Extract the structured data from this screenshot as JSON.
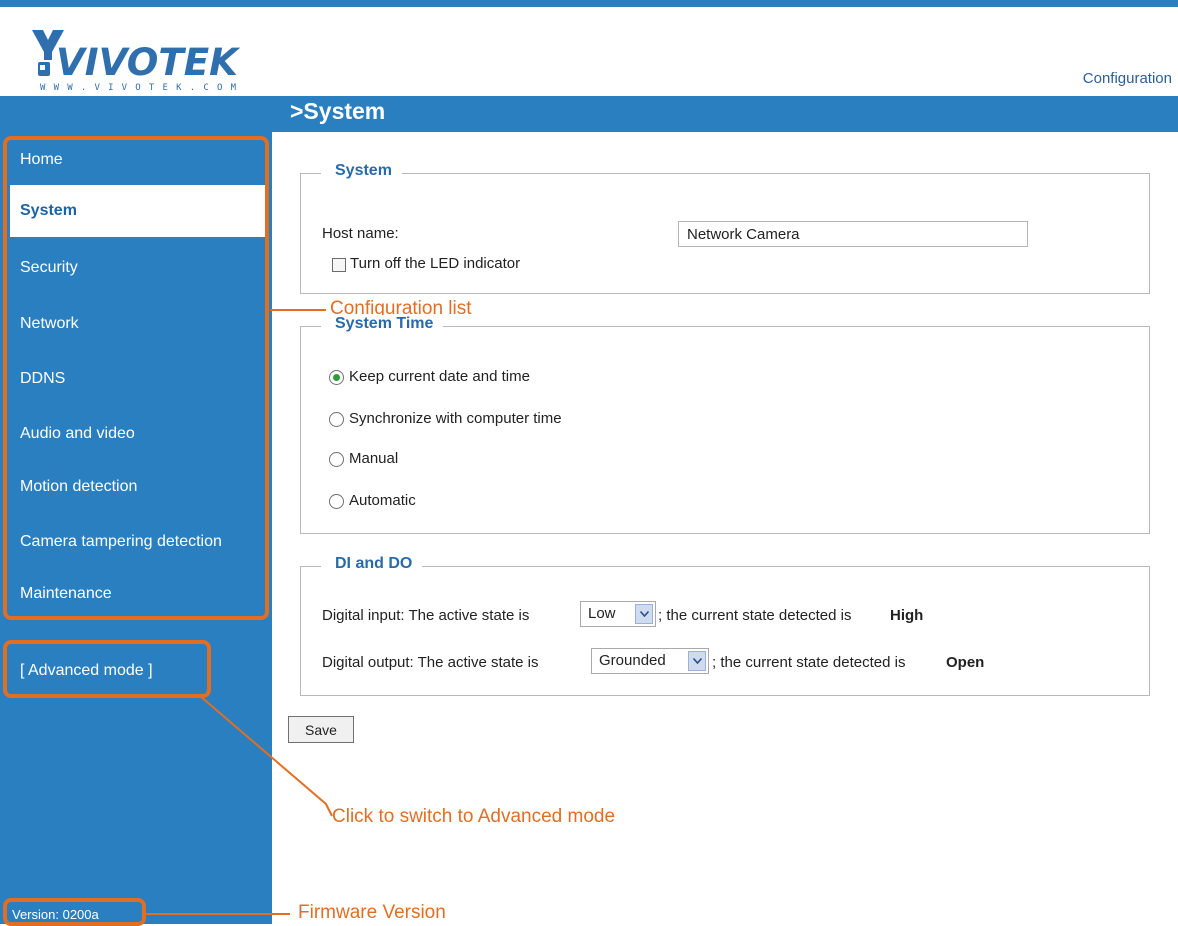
{
  "brand": {
    "logo_text": "VIVOTEK",
    "logo_sub": "WWW.VIVOTEK.COM"
  },
  "header": {
    "config_link": "Configuration",
    "page_title": ">System"
  },
  "sidebar": {
    "items": [
      {
        "label": "Home"
      },
      {
        "label": "System"
      },
      {
        "label": "Security"
      },
      {
        "label": "Network"
      },
      {
        "label": "DDNS"
      },
      {
        "label": "Audio and video"
      },
      {
        "label": "Motion detection"
      },
      {
        "label": "Camera tampering detection"
      },
      {
        "label": "Maintenance"
      }
    ],
    "active": "System",
    "advanced_mode": "[ Advanced mode ]",
    "version": "Version: 0200a"
  },
  "system": {
    "legend": "System",
    "host_label": "Host name:",
    "host_value": "Network Camera",
    "led_label": "Turn off the LED indicator",
    "led_checked": false
  },
  "system_time": {
    "legend": "System Time",
    "options": [
      {
        "label": "Keep current date and time",
        "selected": true
      },
      {
        "label": "Synchronize with computer time",
        "selected": false
      },
      {
        "label": "Manual",
        "selected": false
      },
      {
        "label": "Automatic",
        "selected": false
      }
    ]
  },
  "dido": {
    "legend": "DI and DO",
    "input": {
      "prefix": "Digital input: The active state is",
      "selected": "Low",
      "suffix": "; the current state detected is",
      "state": "High"
    },
    "output": {
      "prefix": "Digital output: The active state is",
      "selected": "Grounded",
      "suffix": "; the current state detected is",
      "state": "Open"
    }
  },
  "save_label": "Save",
  "annotations": {
    "config_list": "Configuration list",
    "advanced": "Click to switch to Advanced mode",
    "firmware": "Firmware Version"
  },
  "colors": {
    "brand_blue": "#2a7fc0",
    "annotation_orange": "#e06f23",
    "legend_blue": "#2a6aa8",
    "radio_green": "#2f9c3a"
  }
}
